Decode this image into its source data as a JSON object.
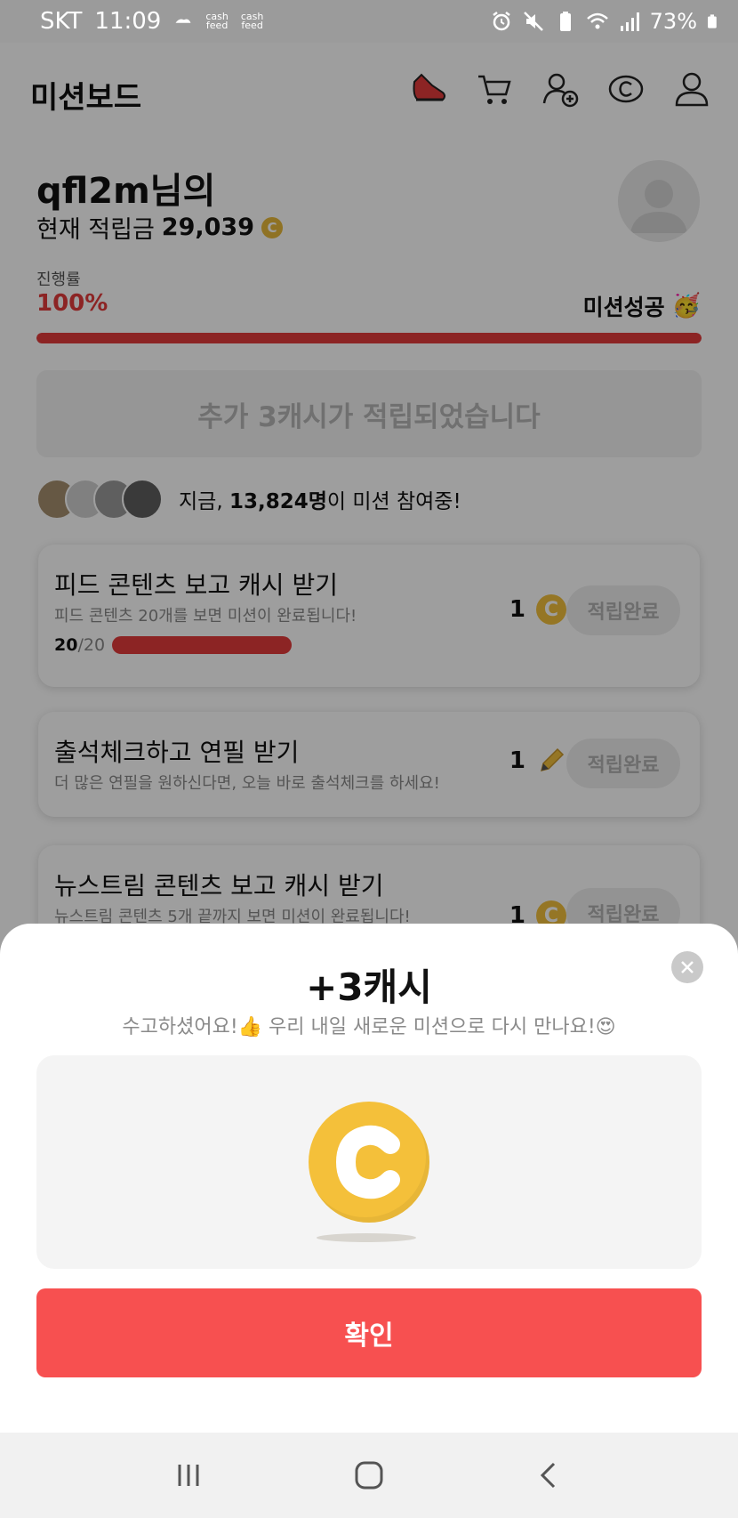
{
  "status_bar": {
    "carrier": "SKT",
    "time": "11:09",
    "notif_label_1": "cash\nfeed",
    "notif_label_2": "cash\nfeed",
    "battery": "73%"
  },
  "header": {
    "title": "미션보드",
    "icons": [
      "sneaker-icon",
      "cart-icon",
      "add-friend-icon",
      "cash-icon",
      "profile-icon"
    ]
  },
  "user": {
    "greeting": "qfl2m님의",
    "balance_label": "현재 적립금",
    "balance_value": "29,039"
  },
  "progress": {
    "label": "진행률",
    "percent_text": "100%",
    "fraction": 1.0,
    "status": "미션성공"
  },
  "notice": "추가 3캐시가 적립되었습니다",
  "participants": {
    "prefix": "지금, ",
    "count": "13,824명",
    "suffix": "이 미션 참여중!"
  },
  "missions": [
    {
      "title": "피드 콘텐츠 보고 캐시 받기",
      "desc": "피드 콘텐츠 20개를 보면 미션이 완료됩니다!",
      "progress_done": "20",
      "progress_total": "/20",
      "reward": "1",
      "reward_icon": "cash-coin-icon",
      "button": "적립완료"
    },
    {
      "title": "출석체크하고 연필 받기",
      "desc": "더 많은 연필을 원하신다면, 오늘 바로 출석체크를 하세요!",
      "reward": "1",
      "reward_icon": "pencil-icon",
      "button": "적립완료"
    },
    {
      "title": "뉴스트림 콘텐츠 보고 캐시 받기",
      "desc": "뉴스트림 콘텐츠 5개 끝까지 보면 미션이 완료됩니다!",
      "reward": "1",
      "reward_icon": "cash-coin-icon",
      "button": "적립완료"
    }
  ],
  "sheet": {
    "title": "+3캐시",
    "subtitle": "수고하셨어요!👍 우리 내일 새로운 미션으로 다시 만나요!😍",
    "confirm": "확인"
  },
  "colors": {
    "accent": "#f75050",
    "progress": "#e23b3b",
    "coin": "#f4c03a"
  }
}
